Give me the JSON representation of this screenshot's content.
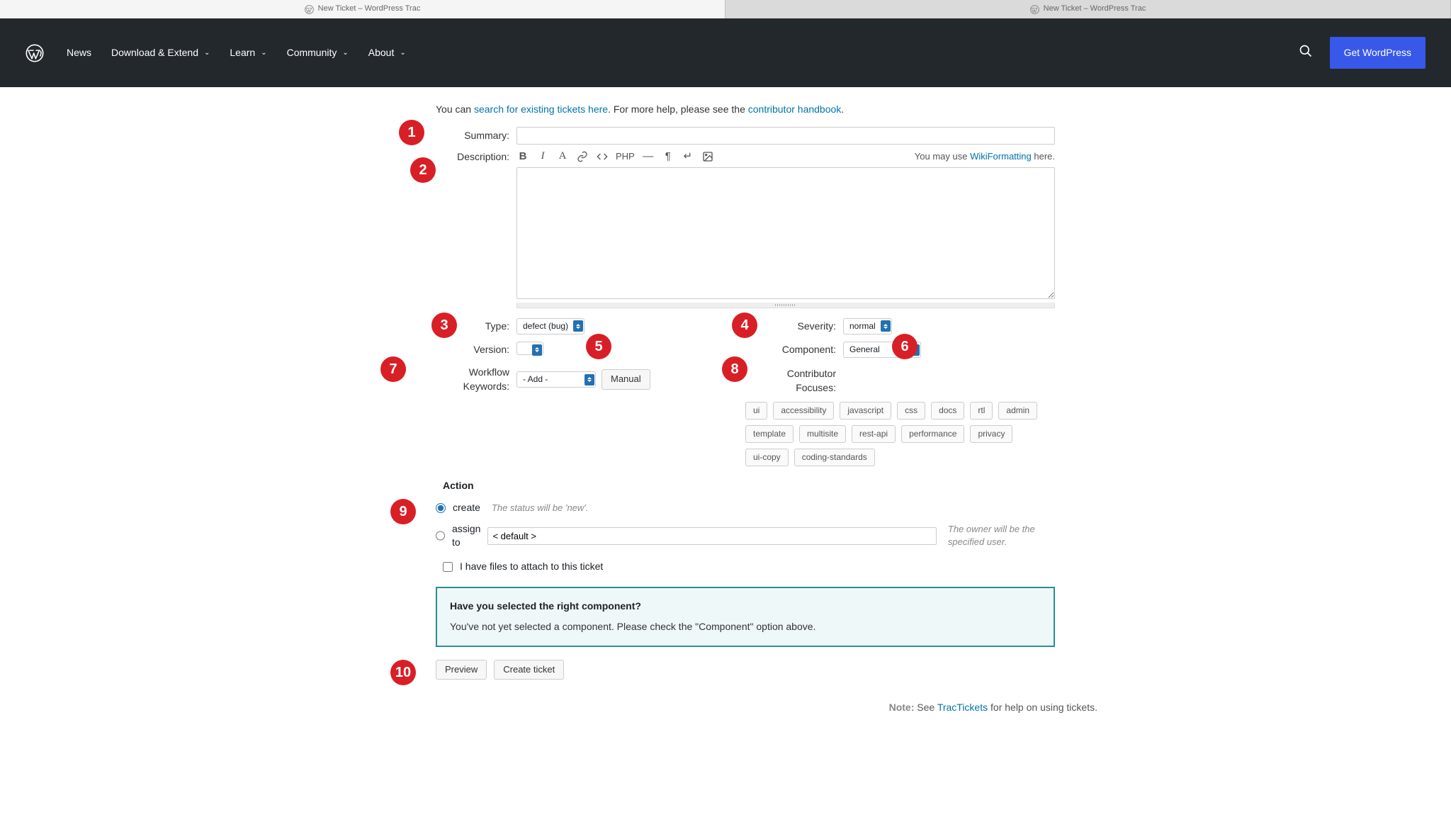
{
  "tabs": {
    "left": "New Ticket – WordPress Trac",
    "right": "New Ticket – WordPress Trac"
  },
  "nav": {
    "news": "News",
    "download_extend": "Download & Extend",
    "learn": "Learn",
    "community": "Community",
    "about": "About",
    "get_wp": "Get WordPress"
  },
  "intro": {
    "pre": "You can ",
    "search_link": "search for existing tickets here",
    "mid": ". For more help, please see the ",
    "handbook_link": "contributor handbook",
    "post": "."
  },
  "labels": {
    "summary": "Summary:",
    "description": "Description:",
    "type": "Type:",
    "severity": "Severity:",
    "version": "Version:",
    "component": "Component:",
    "workflow": "Workflow Keywords:",
    "contributor": "Contributor Focuses:",
    "action": "Action"
  },
  "desc_hint": {
    "pre": "You may use ",
    "link": "WikiFormatting",
    "post": " here."
  },
  "toolbar_php": "PHP",
  "fields": {
    "type_value": "defect (bug)",
    "severity_value": "normal",
    "version_value": "",
    "component_value": "General",
    "workflow_value": "- Add -",
    "manual_btn": "Manual",
    "assign_value": "< default >"
  },
  "focuses": [
    "ui",
    "accessibility",
    "javascript",
    "css",
    "docs",
    "rtl",
    "admin",
    "template",
    "multisite",
    "rest-api",
    "performance",
    "privacy",
    "ui-copy",
    "coding-standards"
  ],
  "actions": {
    "create": "create",
    "create_hint": "The status will be 'new'.",
    "assign": "assign to",
    "assign_hint": "The owner will be the specified user.",
    "attach": "I have files to attach to this ticket"
  },
  "alert": {
    "title": "Have you selected the right component?",
    "body": "You've not yet selected a component. Please check the \"Component\" option above."
  },
  "buttons": {
    "preview": "Preview",
    "create_ticket": "Create ticket"
  },
  "note": {
    "nb": "Note:",
    "pre": " See ",
    "link": "TracTickets",
    "post": " for help on using tickets."
  },
  "ann": {
    "a1": "1",
    "a2": "2",
    "a3": "3",
    "a4": "4",
    "a5": "5",
    "a6": "6",
    "a7": "7",
    "a8": "8",
    "a9": "9",
    "a10": "10"
  }
}
